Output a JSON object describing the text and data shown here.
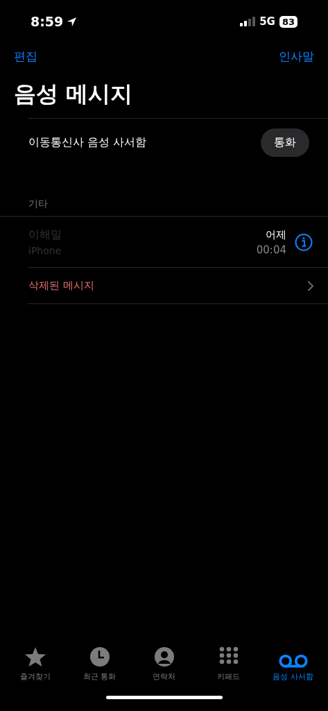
{
  "status_bar": {
    "time": "8:59",
    "network": "5G",
    "battery": "83"
  },
  "nav": {
    "left": "편집",
    "right": "인사말"
  },
  "title": "음성 메시지",
  "carrier": {
    "label": "이동통신사 음성 사서함",
    "button": "통화"
  },
  "section_header": "기타",
  "messages": [
    {
      "name": "이해밀",
      "source": "iPhone",
      "date": "어제",
      "duration": "00:04",
      "dimmed": true
    }
  ],
  "deleted": {
    "label": "삭제된 메시지"
  },
  "tabs": [
    {
      "label": "즐겨찾기",
      "kind": "star",
      "selected": false
    },
    {
      "label": "최근 통화",
      "kind": "clock",
      "selected": false
    },
    {
      "label": "연락처",
      "kind": "person",
      "selected": false
    },
    {
      "label": "키패드",
      "kind": "keypad",
      "selected": false
    },
    {
      "label": "음성 사서함",
      "kind": "voicemail",
      "selected": true
    }
  ]
}
